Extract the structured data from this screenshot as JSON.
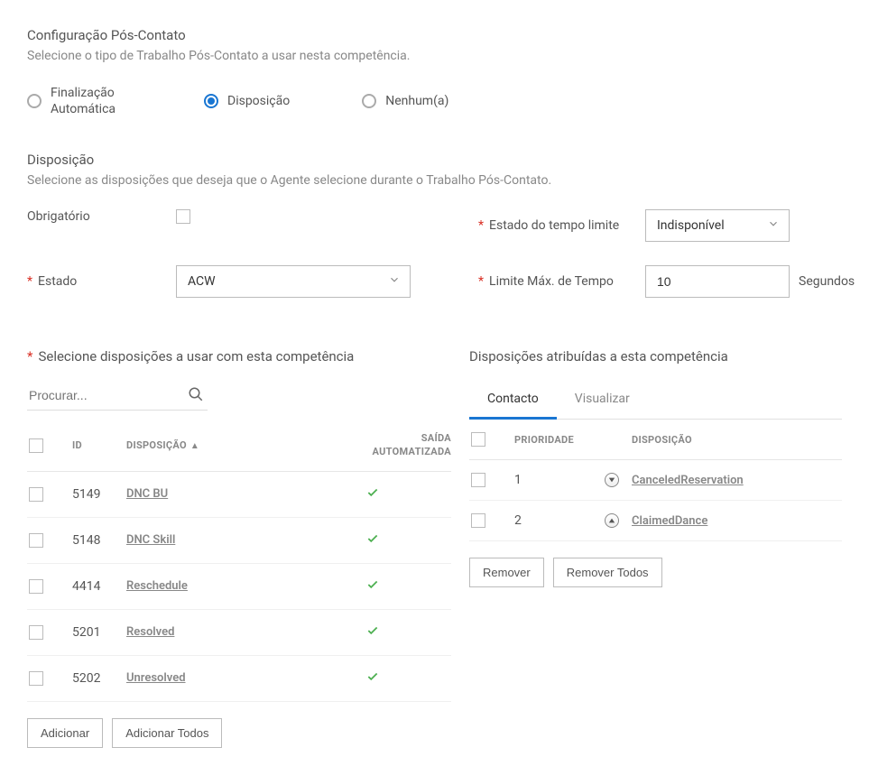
{
  "postContact": {
    "title": "Configuração Pós-Contato",
    "description": "Selecione o tipo de Trabalho Pós-Contato a usar nesta competência.",
    "options": {
      "auto": "Finalização Automática",
      "disposition": "Disposição",
      "none": "Nenhum(a)"
    },
    "selected": "disposition"
  },
  "dispositionSection": {
    "title": "Disposição",
    "description": "Selecione as disposições que deseja que o Agente selecione durante o Trabalho Pós-Contato."
  },
  "fields": {
    "required_label": "Obrigatório",
    "timeout_state_label": "Estado do tempo limite",
    "timeout_state_value": "Indisponível",
    "state_label": "Estado",
    "state_value": "ACW",
    "max_time_label": "Limite Máx. de Tempo",
    "max_time_value": "10",
    "seconds_suffix": "Segundos"
  },
  "availablePanel": {
    "title": "Selecione disposições a usar com esta competência",
    "search_placeholder": "Procurar...",
    "headers": {
      "id": "ID",
      "disp": "DISPOSIÇÃO",
      "auto": "SAÍDA AUTOMATIZADA"
    },
    "rows": [
      {
        "id": "5149",
        "disp": "DNC BU"
      },
      {
        "id": "5148",
        "disp": "DNC Skill"
      },
      {
        "id": "4414",
        "disp": "Reschedule"
      },
      {
        "id": "5201",
        "disp": "Resolved"
      },
      {
        "id": "5202",
        "disp": "Unresolved"
      }
    ],
    "add_btn": "Adicionar",
    "add_all_btn": "Adicionar Todos"
  },
  "assignedPanel": {
    "title": "Disposições atribuídas a esta competência",
    "tabs": {
      "contact": "Contacto",
      "preview": "Visualizar"
    },
    "headers": {
      "prio": "PRIORIDADE",
      "disp": "DISPOSIÇÃO"
    },
    "rows": [
      {
        "prio": "1",
        "disp": "CanceledReservation",
        "dir": "down"
      },
      {
        "prio": "2",
        "disp": "ClaimedDance",
        "dir": "up"
      }
    ],
    "remove_btn": "Remover",
    "remove_all_btn": "Remover Todos"
  }
}
